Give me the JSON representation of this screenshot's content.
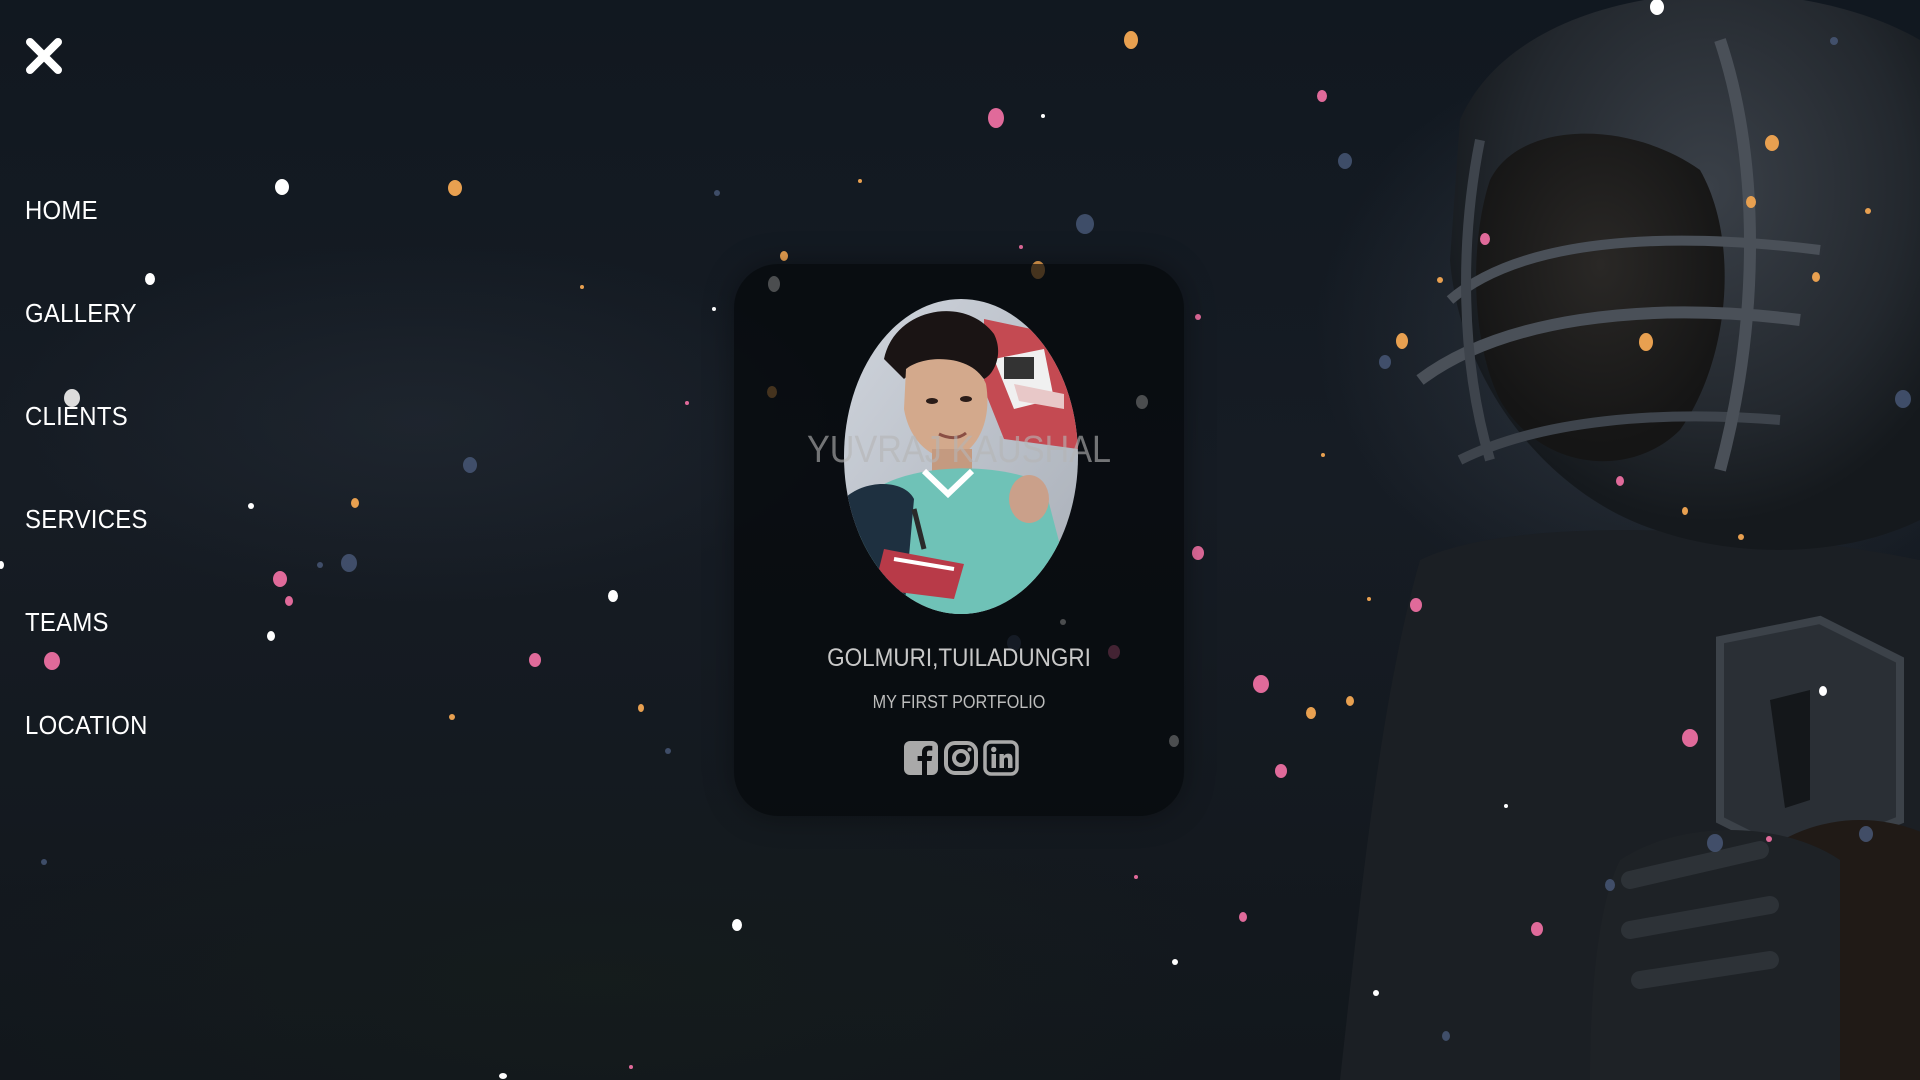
{
  "nav": {
    "close_icon": "close-icon",
    "items": [
      {
        "label": "HOME"
      },
      {
        "label": "GALLERY"
      },
      {
        "label": "CLIENTS"
      },
      {
        "label": "SERVICES"
      },
      {
        "label": "TEAMS"
      },
      {
        "label": "LOCATION"
      }
    ]
  },
  "profile": {
    "name": "YUVRAJ KAUSHAL",
    "location": "GOLMURI,TUILADUNGRI",
    "tagline": "MY FIRST PORTFOLIO",
    "socials": [
      {
        "icon": "facebook-icon"
      },
      {
        "icon": "instagram-icon"
      },
      {
        "icon": "linkedin-icon"
      }
    ]
  },
  "colors": {
    "background": "#12171c",
    "nav_text": "#ffffff",
    "particle_white": "#ffffff",
    "particle_orange": "#e8a050",
    "particle_pink": "#e06a9a",
    "particle_blue": "#4a5a7a"
  }
}
